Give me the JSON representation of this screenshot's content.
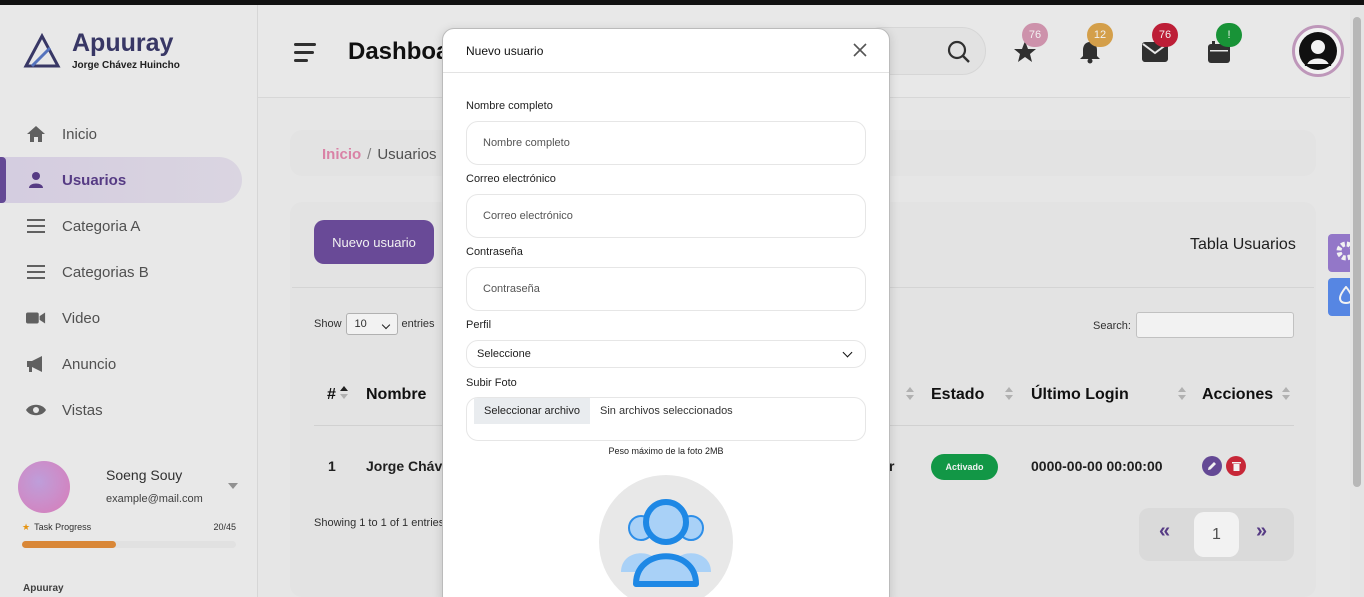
{
  "brand": {
    "name": "Apuuray",
    "subtitle": "Jorge Chávez Huincho"
  },
  "sidebar": {
    "items": [
      {
        "label": "Inicio",
        "icon": "home-icon"
      },
      {
        "label": "Usuarios",
        "icon": "user-icon",
        "active": true
      },
      {
        "label": "Categoria A",
        "icon": "list-icon"
      },
      {
        "label": "Categorias B",
        "icon": "list-icon"
      },
      {
        "label": "Video",
        "icon": "video-icon"
      },
      {
        "label": "Anuncio",
        "icon": "megaphone-icon"
      },
      {
        "label": "Vistas",
        "icon": "eye-icon"
      }
    ],
    "profile": {
      "name": "Soeng Souy",
      "email": "example@mail.com"
    },
    "task": {
      "label": "Task Progress",
      "count": "20/45",
      "progress": 0.44
    },
    "footer": "Apuuray"
  },
  "header": {
    "title": "Dashboard",
    "badges": [
      {
        "icon": "star-icon",
        "count": "76",
        "color": "#d99ab5"
      },
      {
        "icon": "bell-icon",
        "count": "12",
        "color": "#e0a84e"
      },
      {
        "icon": "mail-icon",
        "count": "76",
        "color": "#c8203a"
      },
      {
        "icon": "calendar-icon",
        "count": "!",
        "color": "#1a9b3a"
      }
    ]
  },
  "breadcrumb": {
    "home": "Inicio",
    "separator": "/",
    "current": "Usuarios"
  },
  "main": {
    "new_user_button": "Nuevo usuario",
    "table_title": "Tabla Usuarios",
    "show_label": "Show",
    "entries_value": "10",
    "entries_label": "entries",
    "search_label": "Search:",
    "columns": [
      "#",
      "Nombre",
      "Estado",
      "Último Login",
      "Acciones"
    ],
    "row": {
      "num": "1",
      "name": "Jorge Cháv",
      "partial": "r",
      "status": "Activado",
      "last_login": "0000-00-00 00:00:00"
    },
    "showing": "Showing 1 to 1 of 1 entries",
    "pager": {
      "prev": "«",
      "page": "1",
      "next": "»"
    }
  },
  "modal": {
    "title": "Nuevo usuario",
    "fields": {
      "name_label": "Nombre completo",
      "name_placeholder": "Nombre completo",
      "email_label": "Correo electrónico",
      "email_placeholder": "Correo electrónico",
      "password_label": "Contraseña",
      "password_placeholder": "Contraseña",
      "profile_label": "Perfil",
      "profile_value": "Seleccione",
      "photo_label": "Subir Foto",
      "file_button": "Seleccionar archivo",
      "file_status": "Sin archivos seleccionados",
      "photo_hint": "Peso máximo de la foto 2MB"
    }
  },
  "colors": {
    "accent": "#6f4fa0",
    "active_status": "#14a04a",
    "breadcrumb_home": "#e58aaf"
  }
}
